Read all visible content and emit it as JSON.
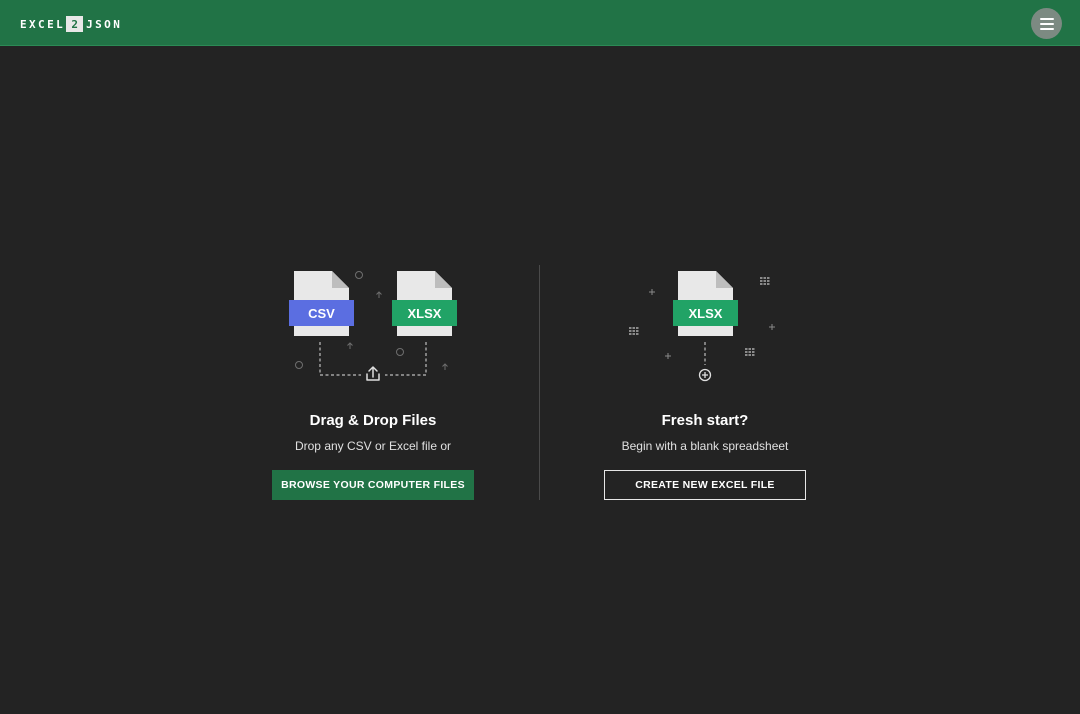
{
  "header": {
    "logo_left": "EXCEL",
    "logo_mid": "2",
    "logo_right": "JSON",
    "menu_icon": "hamburger-menu-icon"
  },
  "left_panel": {
    "badge_csv": "CSV",
    "badge_xlsx": "XLSX",
    "title": "Drag & Drop Files",
    "subtitle": "Drop any CSV or Excel file or",
    "button_label": "BROWSE YOUR COMPUTER FILES",
    "icon": "upload-icon"
  },
  "right_panel": {
    "badge_xlsx": "XLSX",
    "title": "Fresh start?",
    "subtitle": "Begin with a blank spreadsheet",
    "button_label": "CREATE NEW EXCEL FILE",
    "icon": "plus-circle-icon"
  },
  "colors": {
    "brand_green": "#217346",
    "badge_green": "#21a366",
    "csv_blue": "#5b6ee1",
    "background": "#232323",
    "file_gray": "#e8e8e8"
  }
}
